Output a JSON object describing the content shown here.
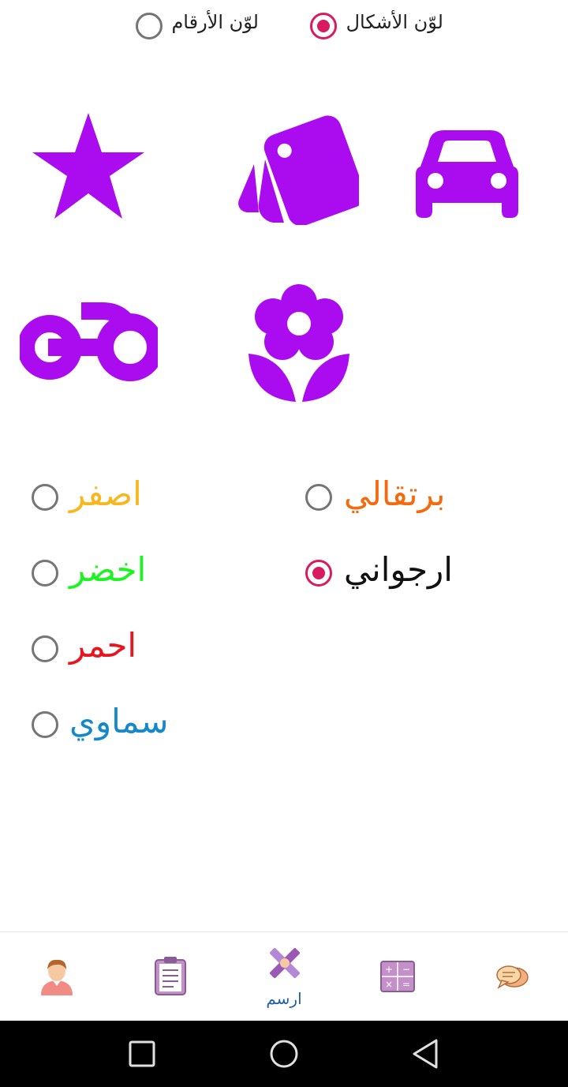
{
  "top_options": {
    "shapes_color": {
      "label": "لوّن الأشكال",
      "selected": true
    },
    "numbers_color": {
      "label": "لوّن الأرقام",
      "selected": false
    }
  },
  "shapes": {
    "fill_color": "#aa0cef",
    "items": [
      "car-icon",
      "cards-icon",
      "star-icon",
      "flower-icon",
      "motorcycle-icon"
    ]
  },
  "colors": {
    "orange": {
      "label": "برتقالي",
      "color": "#f56a0d",
      "selected": false
    },
    "yellow": {
      "label": "اصفر",
      "color": "#f7b71d",
      "selected": false
    },
    "purple": {
      "label": "ارجواني",
      "color": "#111111",
      "selected": true
    },
    "green": {
      "label": "اخضر",
      "color": "#19f51d",
      "selected": false
    },
    "red": {
      "label": "احمر",
      "color": "#e9151e",
      "selected": false
    },
    "sky": {
      "label": "سماوي",
      "color": "#1588c9",
      "selected": false
    }
  },
  "bottom_nav": {
    "items": [
      {
        "icon": "profile-icon"
      },
      {
        "icon": "clipboard-icon"
      },
      {
        "icon": "draw-icon",
        "label": "ارسم",
        "active": true
      },
      {
        "icon": "calculator-icon"
      },
      {
        "icon": "chat-icon"
      }
    ]
  },
  "system_nav": [
    "recent-apps-icon",
    "home-icon",
    "back-icon"
  ],
  "accent_color": "#d81b60"
}
